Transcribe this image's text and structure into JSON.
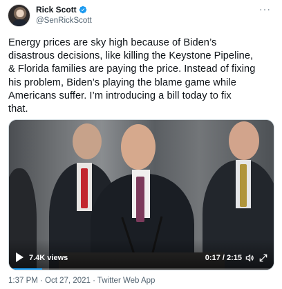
{
  "author": {
    "display_name": "Rick Scott",
    "handle": "@SenRickScott",
    "verified": true
  },
  "more_label": "···",
  "tweet": {
    "text": "Energy prices are sky high because of Biden’s\ndisastrous decisions, like killing the Keystone Pipeline,\n& Florida families are paying the price. Instead of fixing\nhis problem, Biden’s playing the blame game while\nAmericans suffer. I’m introducing a bill today to fix\nthat."
  },
  "video": {
    "views": "7.4K views",
    "time": "0:17 / 2:15",
    "progress": 0.126
  },
  "meta": {
    "timestamp": "1:37 PM · Oct 27, 2021 · Twitter Web App"
  },
  "icons": {
    "verified": "verified-badge-icon",
    "more": "more-options-icon",
    "play": "play-icon",
    "volume": "volume-icon",
    "fullscreen": "fullscreen-icon"
  },
  "colors": {
    "accent": "#1d9bf0",
    "secondary_text": "#536471"
  }
}
